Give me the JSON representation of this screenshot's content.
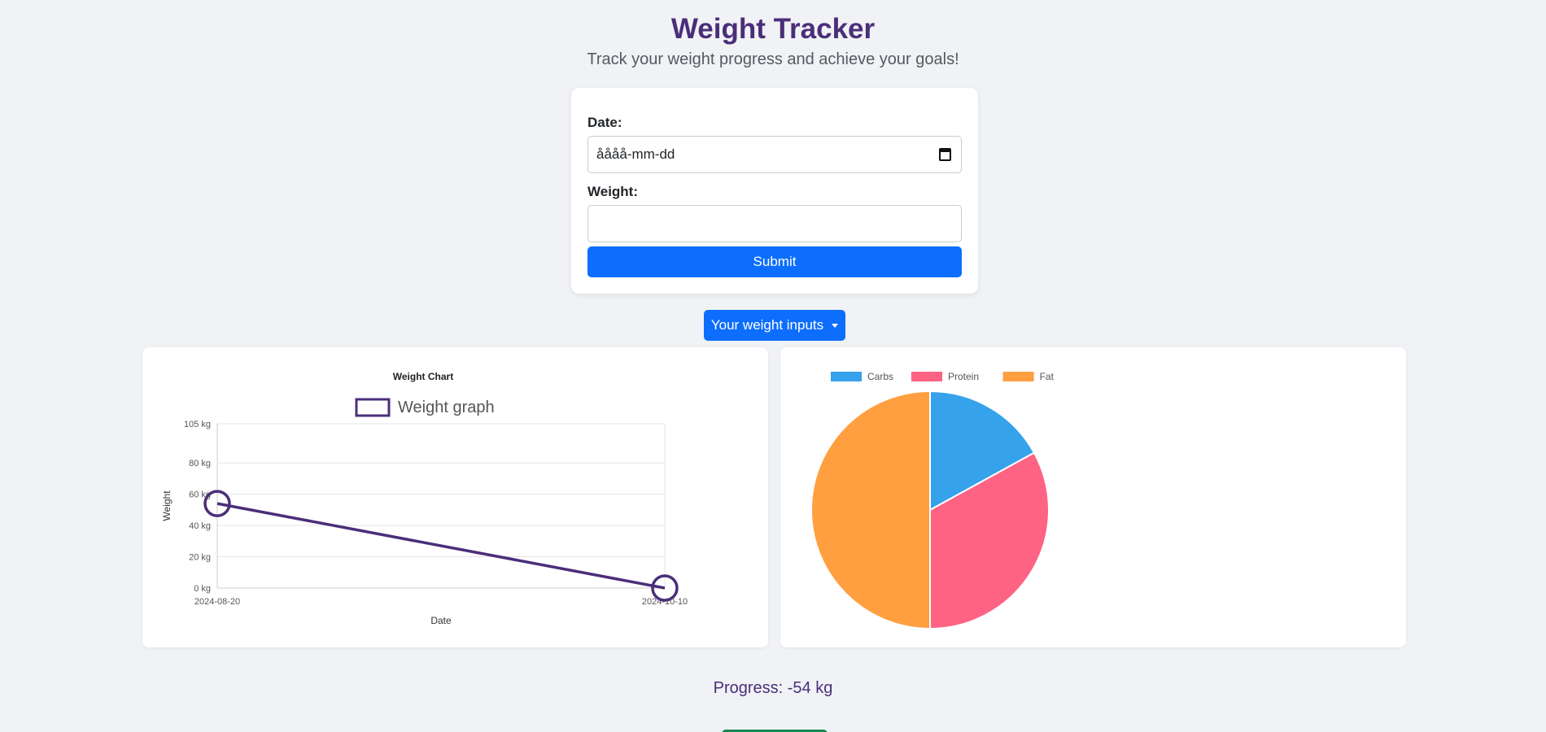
{
  "header": {
    "title": "Weight Tracker",
    "subtitle": "Track your weight progress and achieve your goals!"
  },
  "form": {
    "date_label": "Date:",
    "date_value": "åååå-mm-dd",
    "weight_label": "Weight:",
    "weight_value": "",
    "submit_label": "Submit"
  },
  "dropdown": {
    "label": "Your weight inputs"
  },
  "progress": {
    "text": "Progress: -54 kg"
  },
  "colors": {
    "brand": "#4b2e7a",
    "primary_button": "#0d6efd",
    "line": "#4b2e7a"
  },
  "chart_data": [
    {
      "type": "line",
      "title": "Weight Chart",
      "legend": [
        "Weight graph"
      ],
      "legend_position": "top",
      "xlabel": "Date",
      "ylabel": "Weight",
      "x": [
        "2024-08-20",
        "2024-10-10"
      ],
      "series": [
        {
          "name": "Weight graph",
          "values": [
            54,
            0
          ]
        }
      ],
      "ylim": [
        0,
        105
      ],
      "yticks": [
        "0 kg",
        "20 kg",
        "40 kg",
        "60 kg",
        "80 kg",
        "105 kg"
      ],
      "ytick_values": [
        0,
        20,
        40,
        60,
        80,
        105
      ],
      "grid": true,
      "color": "#4b2e7a"
    },
    {
      "type": "pie",
      "categories": [
        "Carbs",
        "Protein",
        "Fat"
      ],
      "values": [
        17,
        33,
        50
      ],
      "colors": [
        "#36a2eb",
        "#ff6384",
        "#ff9f40"
      ],
      "legend_position": "top-left"
    }
  ]
}
